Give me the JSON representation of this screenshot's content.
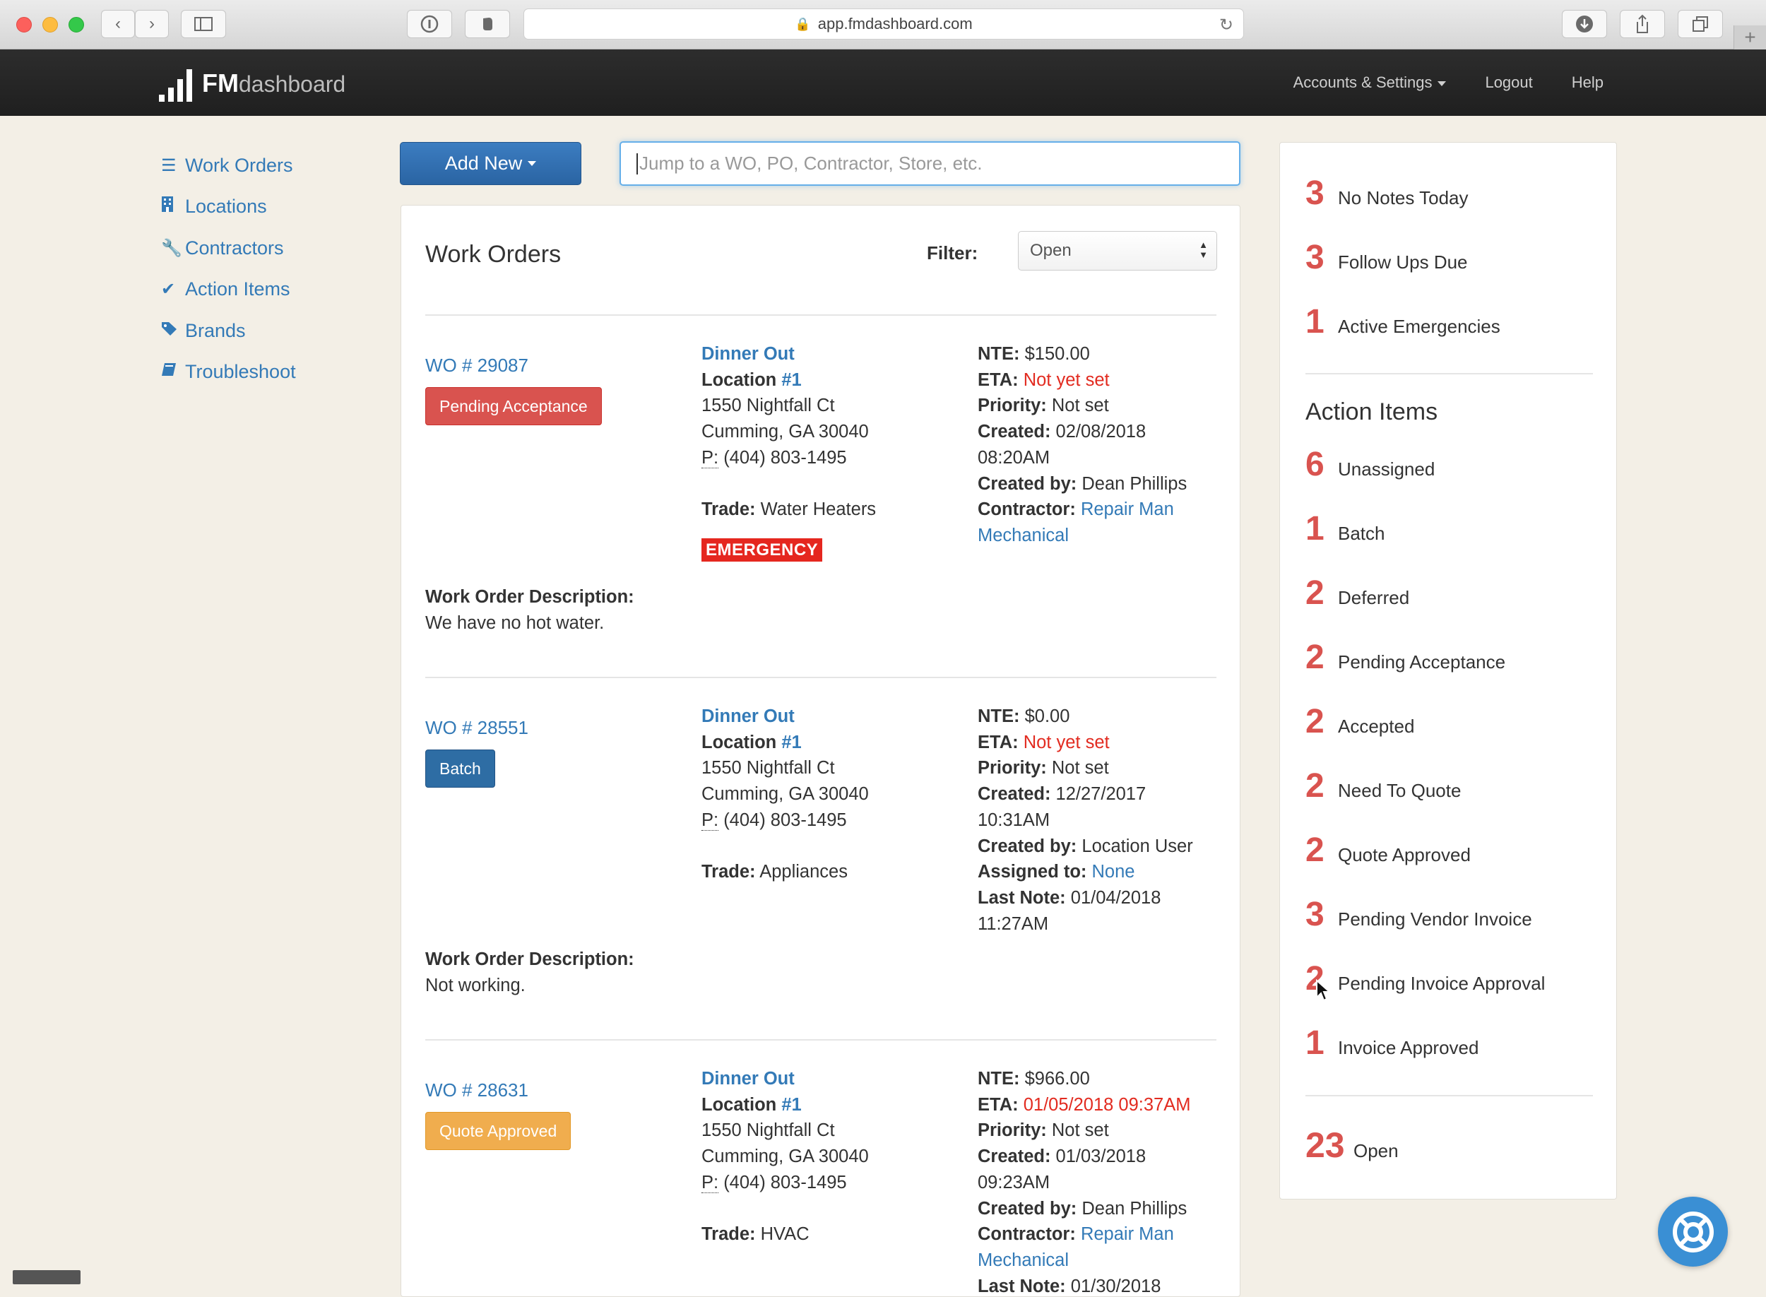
{
  "browser": {
    "url": "app.fmdashboard.com"
  },
  "navbar": {
    "brand_bold": "FM",
    "brand_light": "dashboard",
    "links": [
      "Accounts & Settings",
      "Logout",
      "Help"
    ]
  },
  "sidebar": {
    "items": [
      {
        "label": "Work Orders",
        "icon": "list-icon"
      },
      {
        "label": "Locations",
        "icon": "building-icon"
      },
      {
        "label": "Contractors",
        "icon": "wrench-icon"
      },
      {
        "label": "Action Items",
        "icon": "check-icon"
      },
      {
        "label": "Brands",
        "icon": "tags-icon"
      },
      {
        "label": "Troubleshoot",
        "icon": "book-icon"
      }
    ]
  },
  "toolbar": {
    "add_new_label": "Add New",
    "search_placeholder": "Jump to a WO, PO, Contractor, Store, etc."
  },
  "work_orders": {
    "title": "Work Orders",
    "filter_label": "Filter:",
    "filter_value": "Open",
    "items": [
      {
        "number": "WO # 29087",
        "status": "Pending Acceptance",
        "brand": "Dinner Out",
        "location_label": "Location",
        "location_num": "#1",
        "address1": "1550 Nightfall Ct",
        "address2": "Cumming, GA 30040",
        "phone_prefix": "P:",
        "phone": "(404) 803-1495",
        "trade_label": "Trade:",
        "trade": "Water Heaters",
        "emergency": "EMERGENCY",
        "nte_label": "NTE:",
        "nte": "$150.00",
        "eta_label": "ETA:",
        "eta": "Not yet set",
        "priority_label": "Priority:",
        "priority": "Not set",
        "created_label": "Created:",
        "created_date": "02/08/2018",
        "created_time": "08:20AM",
        "created_by_label": "Created by:",
        "created_by": "Dean Phillips",
        "contractor_label": "Contractor:",
        "contractor_1": "Repair Man",
        "contractor_2": "Mechanical",
        "desc_label": "Work Order Description:",
        "desc": "We have no hot water."
      },
      {
        "number": "WO # 28551",
        "status": "Batch",
        "brand": "Dinner Out",
        "location_label": "Location",
        "location_num": "#1",
        "address1": "1550 Nightfall Ct",
        "address2": "Cumming, GA 30040",
        "phone_prefix": "P:",
        "phone": "(404) 803-1495",
        "trade_label": "Trade:",
        "trade": "Appliances",
        "nte_label": "NTE:",
        "nte": "$0.00",
        "eta_label": "ETA:",
        "eta": "Not yet set",
        "priority_label": "Priority:",
        "priority": "Not set",
        "created_label": "Created:",
        "created_date": "12/27/2017",
        "created_time": "10:31AM",
        "created_by_label": "Created by:",
        "created_by": "Location User",
        "assigned_label": "Assigned to:",
        "assigned": "None",
        "last_note_label": "Last Note:",
        "last_note_date": "01/04/2018",
        "last_note_time": "11:27AM",
        "desc_label": "Work Order Description:",
        "desc": "Not working."
      },
      {
        "number": "WO # 28631",
        "status": "Quote Approved",
        "brand": "Dinner Out",
        "location_label": "Location",
        "location_num": "#1",
        "address1": "1550 Nightfall Ct",
        "address2": "Cumming, GA 30040",
        "phone_prefix": "P:",
        "phone": "(404) 803-1495",
        "trade_label": "Trade:",
        "trade": "HVAC",
        "nte_label": "NTE:",
        "nte": "$966.00",
        "eta_label": "ETA:",
        "eta": "01/05/2018 09:37AM",
        "priority_label": "Priority:",
        "priority": "Not set",
        "created_label": "Created:",
        "created_date": "01/03/2018",
        "created_time": "09:23AM",
        "created_by_label": "Created by:",
        "created_by": "Dean Phillips",
        "contractor_label": "Contractor:",
        "contractor_1": "Repair Man",
        "contractor_2": "Mechanical",
        "last_note_label": "Last Note:",
        "last_note_date": "01/30/2018"
      }
    ]
  },
  "summary": {
    "top": [
      {
        "count": "3",
        "label": "No Notes Today"
      },
      {
        "count": "3",
        "label": "Follow Ups Due"
      },
      {
        "count": "1",
        "label": "Active Emergencies"
      }
    ],
    "action_items_title": "Action Items",
    "action_items": [
      {
        "count": "6",
        "label": "Unassigned"
      },
      {
        "count": "1",
        "label": "Batch"
      },
      {
        "count": "2",
        "label": "Deferred"
      },
      {
        "count": "2",
        "label": "Pending Acceptance"
      },
      {
        "count": "2",
        "label": "Accepted"
      },
      {
        "count": "2",
        "label": "Need To Quote"
      },
      {
        "count": "2",
        "label": "Quote Approved"
      },
      {
        "count": "3",
        "label": "Pending Vendor Invoice"
      },
      {
        "count": "2",
        "label": "Pending Invoice Approval"
      },
      {
        "count": "1",
        "label": "Invoice Approved"
      }
    ],
    "open_count": "23",
    "open_label": "Open"
  },
  "colors": {
    "accent": "#337ab7",
    "danger": "#d9534f",
    "warning": "#f0ad4e",
    "navbar": "#262626"
  }
}
